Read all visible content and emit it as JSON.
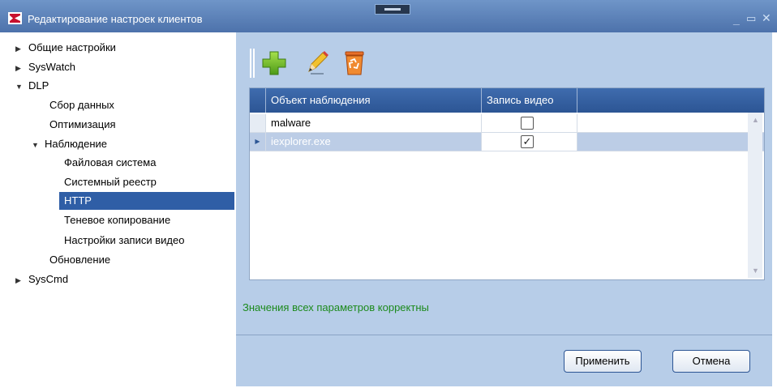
{
  "window": {
    "title": "Редактирование настроек клиентов",
    "controls": {
      "minimize": "_",
      "maximize": "▭",
      "close": "✕"
    }
  },
  "tree": {
    "items": [
      {
        "label": "Общие настройки",
        "arrow": "▶"
      },
      {
        "label": "SysWatch",
        "arrow": "▶"
      },
      {
        "label": "DLP",
        "arrow": "▼"
      },
      {
        "label": "Сбор данных",
        "arrow": ""
      },
      {
        "label": "Оптимизация",
        "arrow": ""
      },
      {
        "label": "Наблюдение",
        "arrow": "▼"
      },
      {
        "label": "Файловая система",
        "arrow": ""
      },
      {
        "label": "Системный реестр",
        "arrow": ""
      },
      {
        "label": "HTTP",
        "arrow": "",
        "selected": true
      },
      {
        "label": "Теневое копирование",
        "arrow": ""
      },
      {
        "label": "Настройки записи видео",
        "arrow": ""
      },
      {
        "label": "Обновление",
        "arrow": ""
      },
      {
        "label": "SysCmd",
        "arrow": "▶"
      }
    ]
  },
  "toolbar": {
    "buttons": [
      {
        "icon": "plus-icon"
      },
      {
        "icon": "pencil-icon"
      },
      {
        "icon": "recycle-bin-icon"
      }
    ]
  },
  "grid": {
    "columns": [
      "Объект наблюдения",
      "Запись видео"
    ],
    "rows": [
      {
        "object": "malware",
        "record_video": false,
        "check": ""
      },
      {
        "object": "iexplorer.exe",
        "record_video": true,
        "check": "✓",
        "selected": true
      }
    ],
    "row_indicator": "▶"
  },
  "status": {
    "text": "Значения всех параметров корректны"
  },
  "buttons": {
    "apply": "Применить",
    "cancel": "Отмена"
  },
  "colors": {
    "titlebar": "#4d72ab",
    "panel": "#b7cde8",
    "selection": "#2f5ea6",
    "status": "#1c8a1c"
  }
}
